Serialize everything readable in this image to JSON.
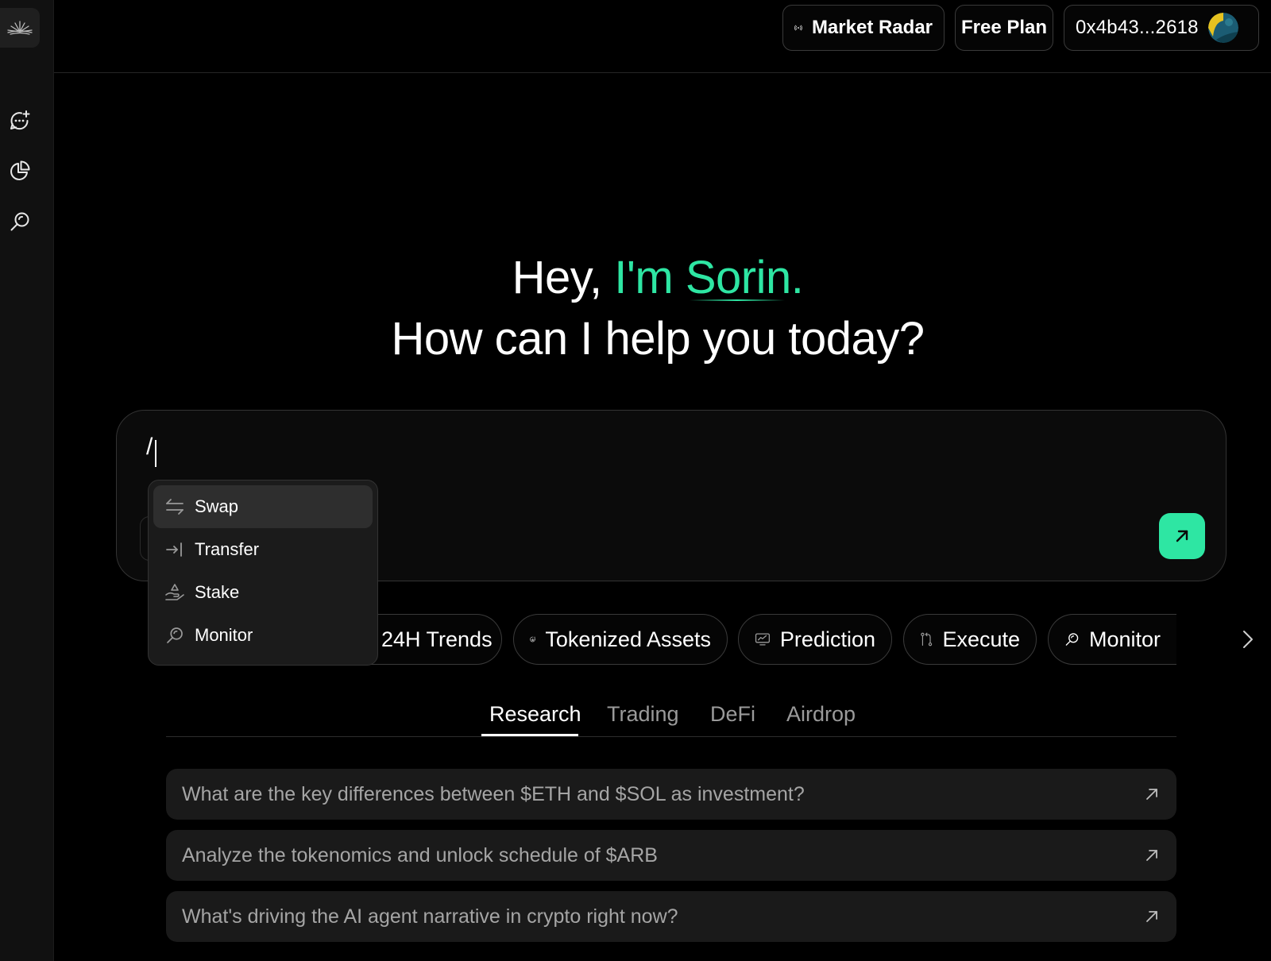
{
  "sidebar": {
    "logo": "sunburst-logo",
    "items": [
      {
        "icon": "new-chat-icon"
      },
      {
        "icon": "pie-chart-icon"
      },
      {
        "icon": "search-icon"
      }
    ]
  },
  "topbar": {
    "market_radar_label": "Market Radar",
    "free_plan_label": "Free Plan",
    "wallet_address": "0x4b43...2618"
  },
  "hero": {
    "greeting_prefix": "Hey, ",
    "greeting_name": "I'm Sorin.",
    "question": "How can I help you today?"
  },
  "chat": {
    "input_value": "/"
  },
  "command_menu": {
    "items": [
      {
        "label": "Swap",
        "icon": "swap-icon",
        "active": true
      },
      {
        "label": "Transfer",
        "icon": "transfer-icon",
        "active": false
      },
      {
        "label": "Stake",
        "icon": "stake-icon",
        "active": false
      },
      {
        "label": "Monitor",
        "icon": "monitor-icon",
        "active": false
      }
    ]
  },
  "quick_actions": [
    {
      "label": "24H Trends",
      "icon": "trends-icon"
    },
    {
      "label": "Tokenized Assets",
      "icon": "tokenized-assets-icon"
    },
    {
      "label": "Prediction",
      "icon": "prediction-icon"
    },
    {
      "label": "Execute",
      "icon": "execute-icon"
    },
    {
      "label": "Monitor",
      "icon": "search-icon"
    }
  ],
  "tabs": [
    {
      "label": "Research",
      "active": true
    },
    {
      "label": "Trading",
      "active": false
    },
    {
      "label": "DeFi",
      "active": false
    },
    {
      "label": "Airdrop",
      "active": false
    }
  ],
  "suggestions": [
    "What are the key differences between $ETH and $SOL as investment?",
    "Analyze the tokenomics and unlock schedule of $ARB",
    "What's driving the AI agent narrative in crypto right now?"
  ],
  "colors": {
    "accent": "#2ee6a3",
    "background": "#000000",
    "sidebar": "#111111",
    "muted_text": "#9a9a9a"
  }
}
